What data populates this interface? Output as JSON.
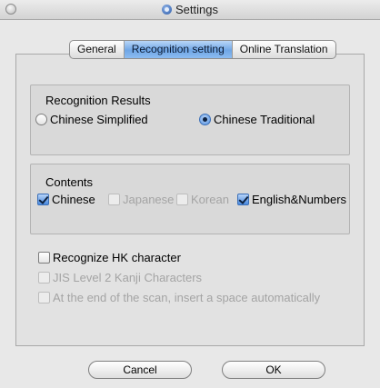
{
  "window": {
    "title": "Settings"
  },
  "tabs": [
    {
      "label": "General",
      "active": false
    },
    {
      "label": "Recognition setting",
      "active": true
    },
    {
      "label": "Online Translation",
      "active": false
    }
  ],
  "recognition_results": {
    "title": "Recognition Results",
    "options": [
      {
        "label": "Chinese Simplified",
        "selected": false
      },
      {
        "label": "Chinese Traditional",
        "selected": true
      }
    ]
  },
  "contents": {
    "title": "Contents",
    "options": [
      {
        "label": "Chinese",
        "checked": true,
        "enabled": true
      },
      {
        "label": "Japanese",
        "checked": false,
        "enabled": false
      },
      {
        "label": "Korean",
        "checked": false,
        "enabled": false
      },
      {
        "label": "English&Numbers",
        "checked": true,
        "enabled": true
      }
    ]
  },
  "extra_options": [
    {
      "label": "Recognize HK character",
      "checked": false,
      "enabled": true
    },
    {
      "label": "JIS Level 2 Kanji Characters",
      "checked": false,
      "enabled": false
    },
    {
      "label": "At the end of the scan, insert a space automatically",
      "checked": false,
      "enabled": false
    }
  ],
  "buttons": {
    "cancel": "Cancel",
    "ok": "OK"
  },
  "colors": {
    "accent": "#4f8ee0",
    "background": "#e8e8e8",
    "disabled_text": "#a4a4a4"
  },
  "icons": {
    "window_control": "close-circle",
    "app": "app-icon"
  }
}
